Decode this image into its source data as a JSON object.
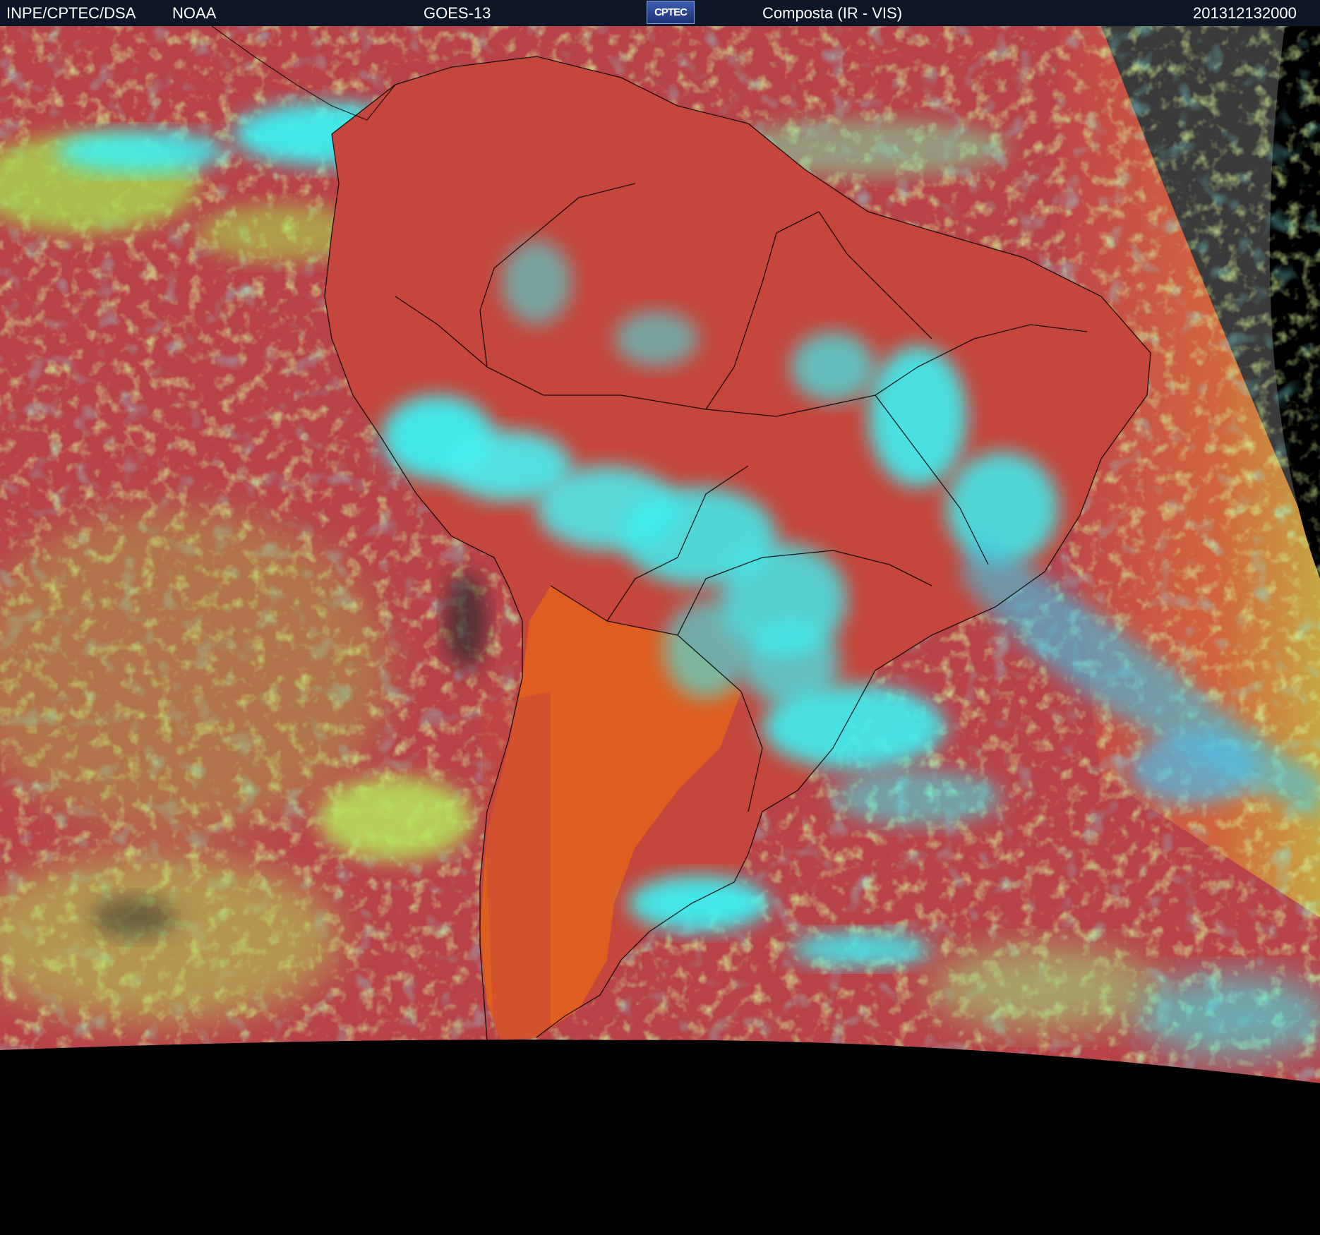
{
  "header": {
    "agency": "INPE/CPTEC/DSA",
    "source": "NOAA",
    "satellite": "GOES-13",
    "logo_text": "CPTEC",
    "product": "Composta (IR - VIS)",
    "timestamp": "201312132000"
  },
  "colors": {
    "header_bg": "#0c1626",
    "ocean_clear": "#b8424a",
    "land_clear": "#c4463c",
    "desert_warm": "#e0601e",
    "low_cloud": "#a8e04c",
    "high_cloud": "#3ef0f2",
    "night_side": "#3a3a3a",
    "space": "#000000",
    "borders": "#000000"
  },
  "legend_icon": "cptec-logo"
}
